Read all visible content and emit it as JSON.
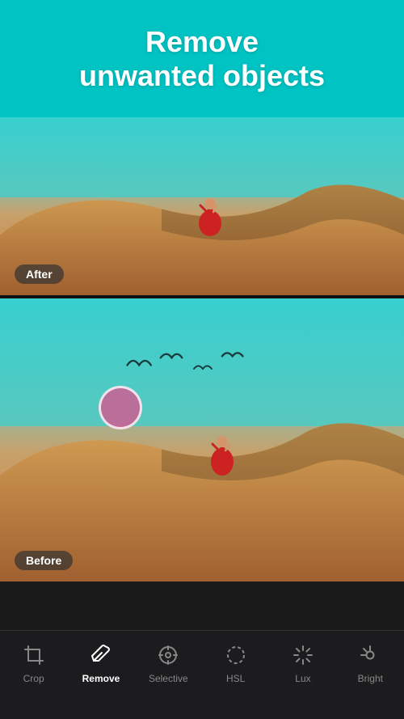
{
  "header": {
    "title_line1": "Remove",
    "title_line2": "unwanted objects",
    "bg_color": "#2ecece"
  },
  "after_image": {
    "label": "After"
  },
  "before_image": {
    "label": "Before"
  },
  "toolbar": {
    "tools": [
      {
        "id": "crop",
        "label": "Crop",
        "active": false
      },
      {
        "id": "remove",
        "label": "Remove",
        "active": true
      },
      {
        "id": "selective",
        "label": "Selective",
        "active": false
      },
      {
        "id": "hsl",
        "label": "HSL",
        "active": false
      },
      {
        "id": "lux",
        "label": "Lux",
        "active": false
      },
      {
        "id": "bright",
        "label": "Bright",
        "active": false
      }
    ]
  }
}
